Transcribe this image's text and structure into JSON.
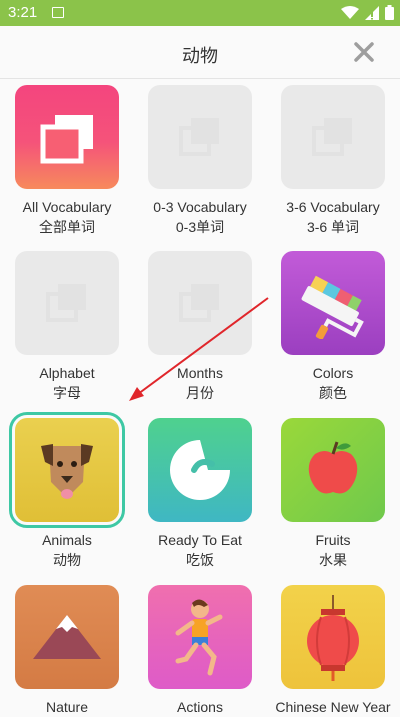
{
  "status": {
    "time": "3:21"
  },
  "header": {
    "title": "动物"
  },
  "tiles": [
    {
      "en": "All Vocabulary",
      "zh": "全部单词"
    },
    {
      "en": "0-3 Vocabulary",
      "zh": "0-3单词"
    },
    {
      "en": "3-6 Vocabulary",
      "zh": "3-6 单词"
    },
    {
      "en": "Alphabet",
      "zh": "字母"
    },
    {
      "en": "Months",
      "zh": "月份"
    },
    {
      "en": "Colors",
      "zh": "颜色"
    },
    {
      "en": "Animals",
      "zh": "动物"
    },
    {
      "en": "Ready To Eat",
      "zh": "吃饭"
    },
    {
      "en": "Fruits",
      "zh": "水果"
    },
    {
      "en": "Nature",
      "zh": ""
    },
    {
      "en": "Actions",
      "zh": ""
    },
    {
      "en": "Chinese New Year",
      "zh": ""
    }
  ],
  "colors": {
    "statusbar": "#8bc34a",
    "selected_outline": "#3ec8a4",
    "arrow": "#e0262b"
  }
}
